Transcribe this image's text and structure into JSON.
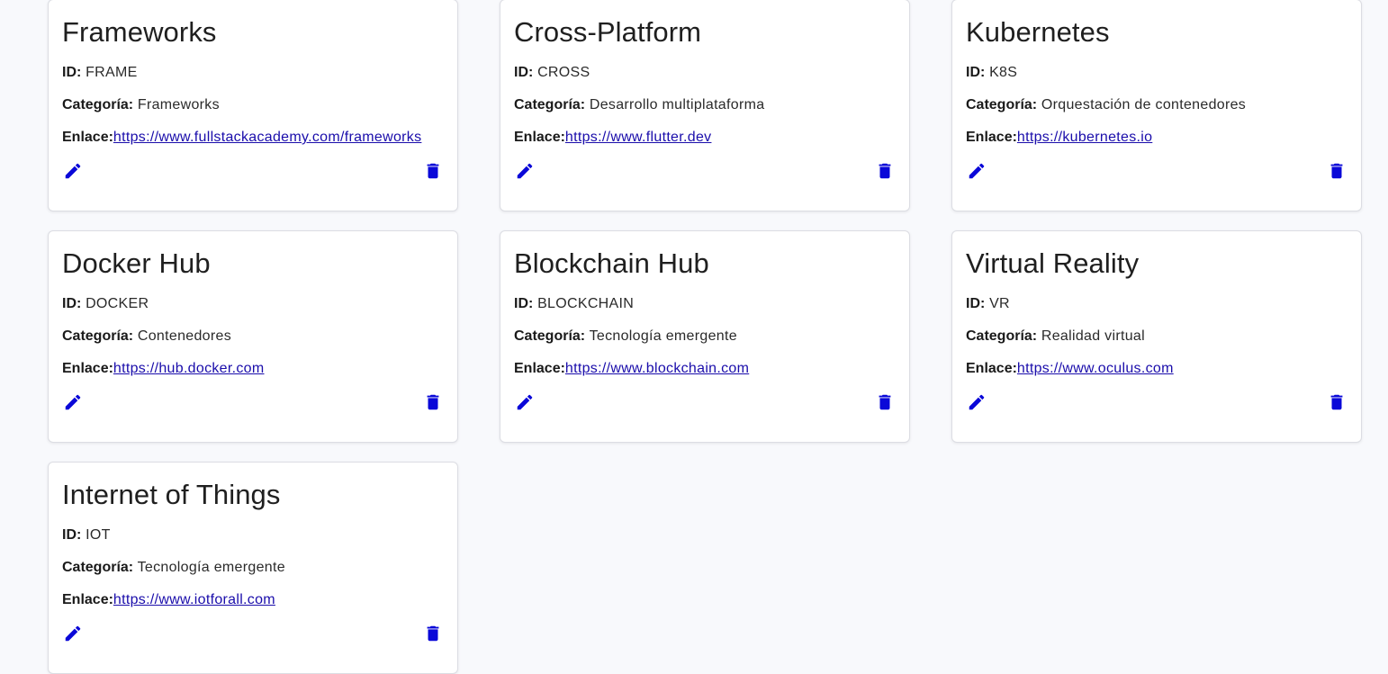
{
  "labels": {
    "id": "ID:",
    "category": "Categoría:",
    "link": "Enlace:"
  },
  "colors": {
    "accent": "#0a08d8",
    "link": "#1a0dab",
    "background": "#f8f9fc"
  },
  "icons": {
    "edit": "pencil-icon",
    "delete": "trash-icon"
  },
  "cards": [
    {
      "title": "Frameworks",
      "id": "FRAME",
      "category": "Frameworks",
      "link": "https://www.fullstackacademy.com/frameworks"
    },
    {
      "title": "Cross-Platform",
      "id": "CROSS",
      "category": "Desarrollo multiplataforma",
      "link": "https://www.flutter.dev"
    },
    {
      "title": "Kubernetes",
      "id": "K8S",
      "category": "Orquestación de contenedores",
      "link": "https://kubernetes.io"
    },
    {
      "title": "Docker Hub",
      "id": "DOCKER",
      "category": "Contenedores",
      "link": "https://hub.docker.com"
    },
    {
      "title": "Blockchain Hub",
      "id": "BLOCKCHAIN",
      "category": "Tecnología emergente",
      "link": "https://www.blockchain.com"
    },
    {
      "title": "Virtual Reality",
      "id": "VR",
      "category": "Realidad virtual",
      "link": "https://www.oculus.com"
    },
    {
      "title": "Internet of Things",
      "id": "IOT",
      "category": "Tecnología emergente",
      "link": "https://www.iotforall.com"
    }
  ]
}
